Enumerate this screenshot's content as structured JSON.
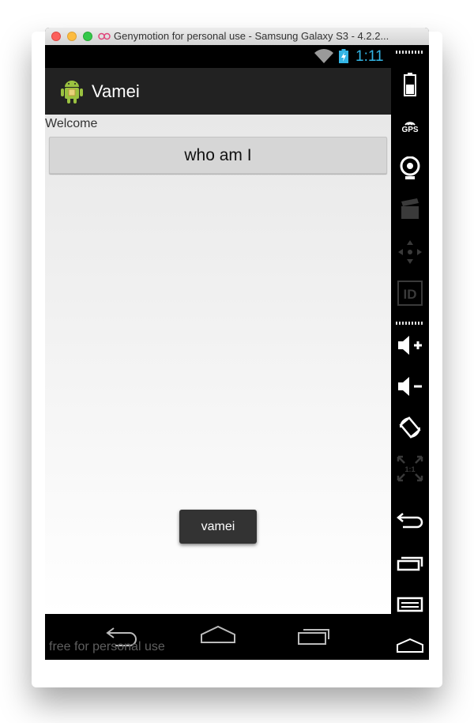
{
  "window": {
    "title": "Genymotion for personal use - Samsung Galaxy S3 - 4.2.2..."
  },
  "statusbar": {
    "time": "1:11",
    "icons": [
      "wifi-icon",
      "battery-charging-icon"
    ]
  },
  "actionbar": {
    "title": "Vamei",
    "icon": "android-robot-icon"
  },
  "content": {
    "welcome_text": "Welcome",
    "button_label": "who am I"
  },
  "toast": {
    "text": "vamei"
  },
  "navbar": {
    "icons": [
      "back-icon",
      "home-icon",
      "recent-apps-icon"
    ],
    "watermark": "free for personal use"
  },
  "sidebar": {
    "gps_label": "GPS",
    "id_label": "ID",
    "fit_label": "1:1",
    "icons": [
      "battery-icon",
      "gps-icon",
      "webcam-icon",
      "video-capture-icon",
      "dpad-icon",
      "device-id-icon",
      "volume-up-icon",
      "volume-down-icon",
      "rotate-icon",
      "fit-to-screen-icon",
      "back-icon",
      "recent-apps-icon",
      "menu-icon",
      "home-icon"
    ]
  },
  "colors": {
    "status_time": "#33b5e5",
    "actionbar": "#222222",
    "toast_bg": "#333333"
  }
}
